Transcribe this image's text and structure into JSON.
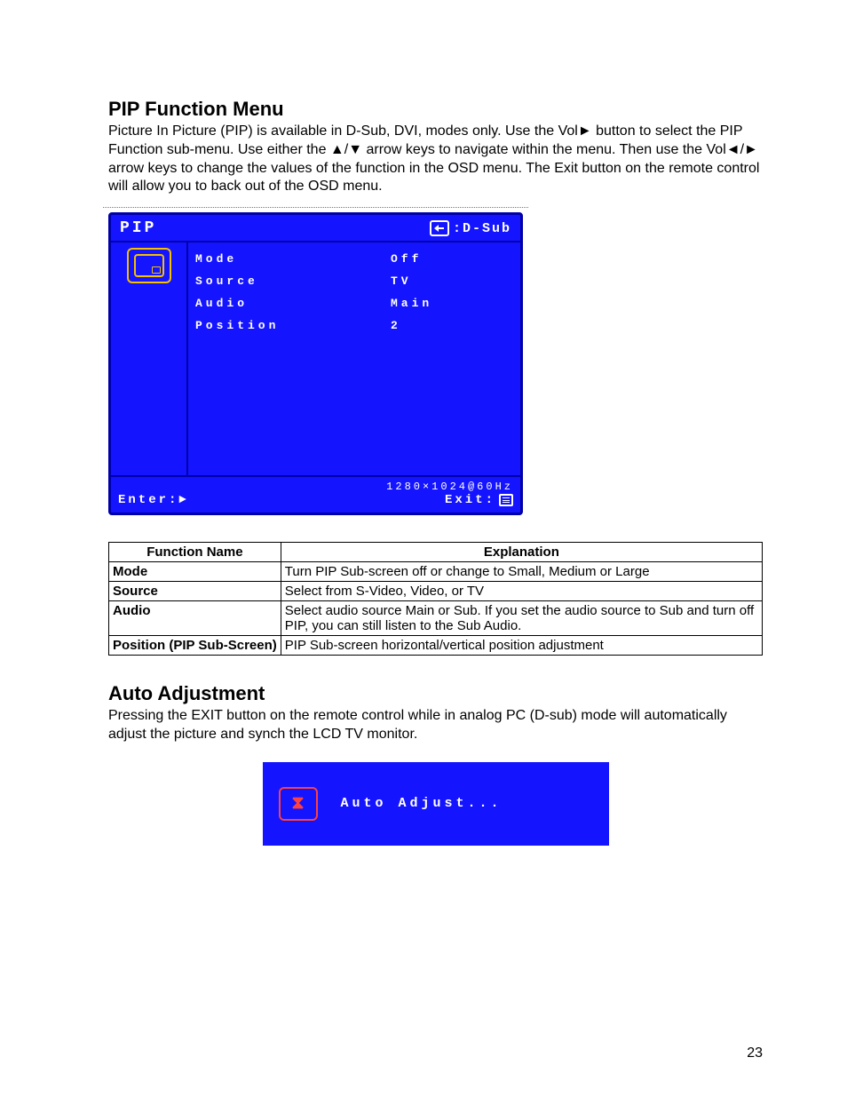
{
  "section1": {
    "title": "PIP Function Menu",
    "para": "Picture In Picture (PIP) is available in D-Sub, DVI, modes only. Use the Vol► button to select the PIP Function sub-menu. Use either the ▲/▼ arrow keys to navigate within the menu. Then use the Vol◄/► arrow keys to change the values of the function in the OSD menu. The Exit button on the remote control will allow you to back out of the OSD menu."
  },
  "osd": {
    "title": "PIP",
    "input_label": ":D-Sub",
    "rows": [
      {
        "k": "Mode",
        "v": "Off"
      },
      {
        "k": "Source",
        "v": "TV"
      },
      {
        "k": "Audio",
        "v": "Main"
      },
      {
        "k": "Position",
        "v": "2"
      }
    ],
    "resolution": "1280×1024@60Hz",
    "enter": "Enter:►",
    "exit": "Exit:"
  },
  "fn_table": {
    "headers": [
      "Function Name",
      "Explanation"
    ],
    "rows": [
      {
        "name": "Mode",
        "exp": "Turn PIP Sub-screen off or change to Small, Medium or Large"
      },
      {
        "name": "Source",
        "exp": "Select from S-Video, Video, or TV"
      },
      {
        "name": "Audio",
        "exp": "Select audio source Main or Sub. If you set the audio source to Sub and turn off PIP, you can still listen to the Sub Audio."
      },
      {
        "name": "Position (PIP Sub-Screen)",
        "exp": "PIP Sub-screen horizontal/vertical position adjustment"
      }
    ]
  },
  "section2": {
    "title": "Auto Adjustment",
    "para": "Pressing the EXIT button on the remote control while in analog PC (D-sub) mode will automatically adjust the picture and synch the LCD TV monitor."
  },
  "auto": {
    "text": "Auto Adjust..."
  },
  "page_number": "23"
}
